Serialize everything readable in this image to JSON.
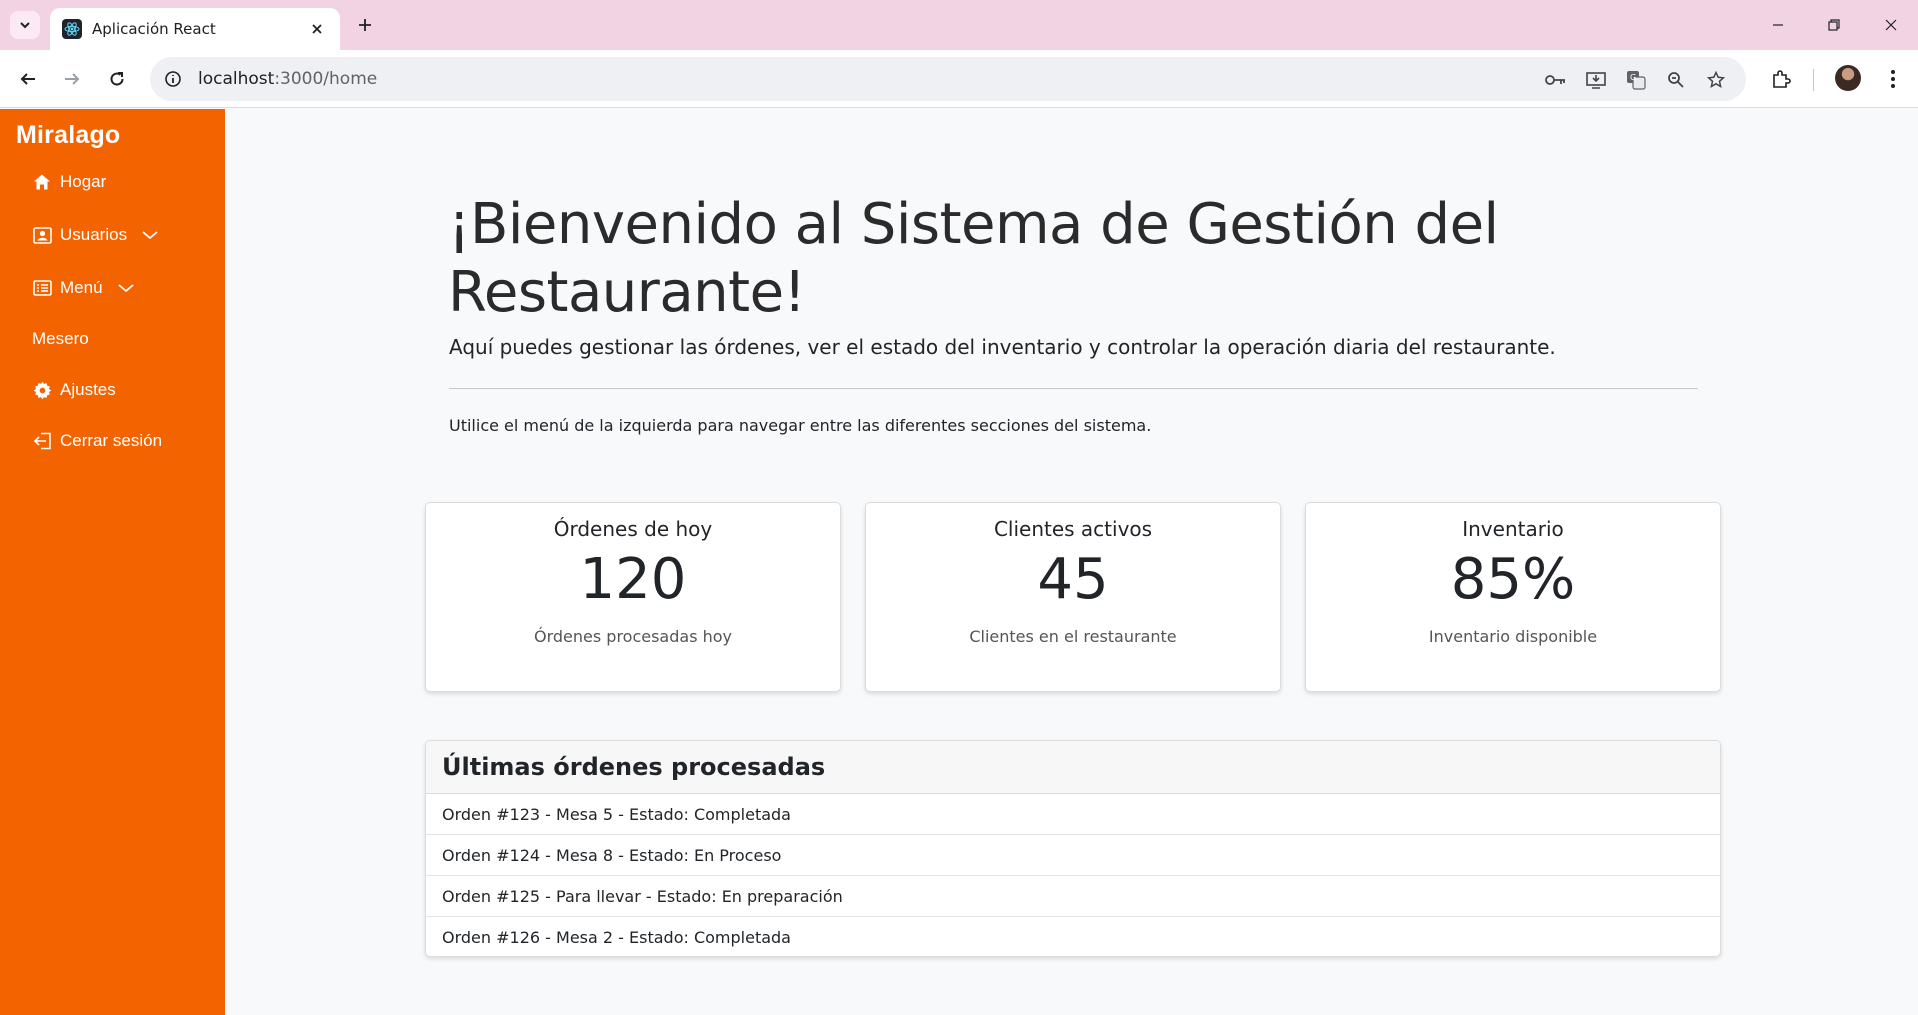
{
  "browser": {
    "tab_title": "Aplicación React",
    "url_host": "localhost",
    "url_path": ":3000/home"
  },
  "sidebar": {
    "brand": "Miralago",
    "items": [
      {
        "label": "Hogar",
        "icon": "home-icon"
      },
      {
        "label": "Usuarios",
        "icon": "user-card-icon",
        "has_dropdown": true
      },
      {
        "label": "Menú",
        "icon": "menu-list-icon",
        "has_dropdown": true
      },
      {
        "label": "Mesero",
        "icon": ""
      },
      {
        "label": "Ajustes",
        "icon": "gear-icon"
      },
      {
        "label": "Cerrar sesión",
        "icon": "logout-icon"
      }
    ]
  },
  "hero": {
    "title": "¡Bienvenido al Sistema de Gestión del Restaurante!",
    "lead": "Aquí puedes gestionar las órdenes, ver el estado del inventario y controlar la operación diaria del restaurante.",
    "note": "Utilice el menú de la izquierda para navegar entre las diferentes secciones del sistema."
  },
  "cards": [
    {
      "title": "Órdenes de hoy",
      "value": "120",
      "text": "Órdenes procesadas hoy"
    },
    {
      "title": "Clientes activos",
      "value": "45",
      "text": "Clientes en el restaurante"
    },
    {
      "title": "Inventario",
      "value": "85%",
      "text": "Inventario disponible"
    }
  ],
  "orders": {
    "header": "Últimas órdenes procesadas",
    "rows": [
      "Orden #123 - Mesa 5 - Estado: Completada",
      "Orden #124 - Mesa 8 - Estado: En Proceso",
      "Orden #125 - Para llevar - Estado: En preparación",
      "Orden #126 - Mesa 2 - Estado: Completada"
    ]
  },
  "colors": {
    "sidebar": "#f36401",
    "tabbar": "#f1d3e4",
    "page_bg": "#f8f9fa"
  }
}
